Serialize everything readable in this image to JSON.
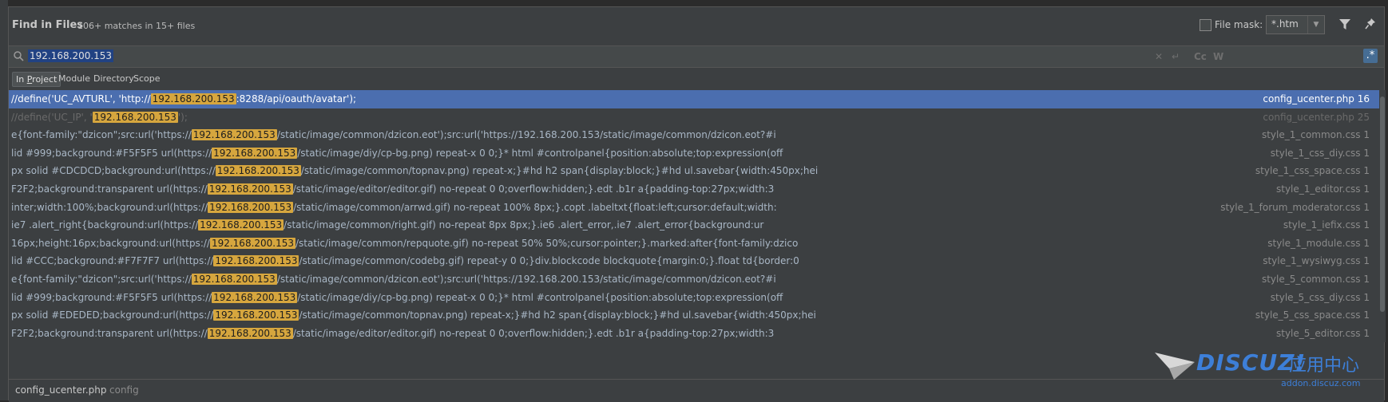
{
  "header": {
    "title": "Find in Files",
    "match_count": "106+ matches in 15+ files",
    "file_mask_label": "File mask:",
    "file_mask_value": "*.htm"
  },
  "search": {
    "query": "192.168.200.153"
  },
  "scopes": [
    "In Project",
    "Module",
    "Directory",
    "Scope"
  ],
  "results": [
    {
      "pre": "//define('UC_AVTURL', 'http://",
      "match": "192.168.200.153",
      "post": ":8288/api/oauth/avatar');",
      "file": "config_ucenter.php 16",
      "selected": true,
      "dim": false
    },
    {
      "pre": "//define('UC_IP', '",
      "match": "192.168.200.153",
      "post": "');",
      "file": "config_ucenter.php 25",
      "selected": false,
      "dim": true
    },
    {
      "pre": "e{font-family:\"dzicon\";src:url('https://",
      "match": "192.168.200.153",
      "post": "/static/image/common/dzicon.eot');src:url('https://192.168.200.153/static/image/common/dzicon.eot?#i",
      "file": "style_1_common.css 1",
      "selected": false,
      "dim": false
    },
    {
      "pre": "lid #999;background:#F5F5F5 url(https://",
      "match": "192.168.200.153",
      "post": "/static/image/diy/cp-bg.png) repeat-x 0 0;}* html #controlpanel{position:absolute;top:expression(off",
      "file": "style_1_css_diy.css 1",
      "selected": false,
      "dim": false
    },
    {
      "pre": "px solid #CDCDCD;background:url(https://",
      "match": "192.168.200.153",
      "post": "/static/image/common/topnav.png) repeat-x;}#hd h2 span{display:block;}#hd ul.savebar{width:450px;hei",
      "file": "style_1_css_space.css 1",
      "selected": false,
      "dim": false
    },
    {
      "pre": "F2F2;background:transparent url(https://",
      "match": "192.168.200.153",
      "post": "/static/image/editor/editor.gif) no-repeat 0 0;overflow:hidden;}.edt .b1r a{padding-top:27px;width:3",
      "file": "style_1_editor.css 1",
      "selected": false,
      "dim": false
    },
    {
      "pre": "inter;width:100%;background:url(https://",
      "match": "192.168.200.153",
      "post": "/static/image/common/arrwd.gif) no-repeat 100% 8px;}.copt .labeltxt{float:left;cursor:default;width:",
      "file": "style_1_forum_moderator.css 1",
      "selected": false,
      "dim": false
    },
    {
      "pre": "ie7 .alert_right{background:url(https://",
      "match": "192.168.200.153",
      "post": "/static/image/common/right.gif) no-repeat 8px 8px;}.ie6 .alert_error,.ie7 .alert_error{background:ur",
      "file": "style_1_iefix.css 1",
      "selected": false,
      "dim": false
    },
    {
      "pre": "16px;height:16px;background:url(https://",
      "match": "192.168.200.153",
      "post": "/static/image/common/repquote.gif) no-repeat 50% 50%;cursor:pointer;}.marked:after{font-family:dzico",
      "file": "style_1_module.css 1",
      "selected": false,
      "dim": false
    },
    {
      "pre": "lid #CCC;background:#F7F7F7 url(https://",
      "match": "192.168.200.153",
      "post": "/static/image/common/codebg.gif) repeat-y 0 0;}div.blockcode blockquote{margin:0;}.float td{border:0",
      "file": "style_1_wysiwyg.css 1",
      "selected": false,
      "dim": false
    },
    {
      "pre": "e{font-family:\"dzicon\";src:url('https://",
      "match": "192.168.200.153",
      "post": "/static/image/common/dzicon.eot');src:url('https://192.168.200.153/static/image/common/dzicon.eot?#i",
      "file": "style_5_common.css 1",
      "selected": false,
      "dim": false
    },
    {
      "pre": "lid #999;background:#F5F5F5 url(https://",
      "match": "192.168.200.153",
      "post": "/static/image/diy/cp-bg.png) repeat-x 0 0;}* html #controlpanel{position:absolute;top:expression(off",
      "file": "style_5_css_diy.css 1",
      "selected": false,
      "dim": false
    },
    {
      "pre": "px solid #EDEDED;background:url(https://",
      "match": "192.168.200.153",
      "post": "/static/image/common/topnav.png) repeat-x;}#hd h2 span{display:block;}#hd ul.savebar{width:450px;hei",
      "file": "style_5_css_space.css 1",
      "selected": false,
      "dim": false
    },
    {
      "pre": "F2F2;background:transparent url(https://",
      "match": "192.168.200.153",
      "post": "/static/image/editor/editor.gif) no-repeat 0 0;overflow:hidden;}.edt .b1r a{padding-top:27px;width:3",
      "file": "style_5_editor.css 1",
      "selected": false,
      "dim": false
    }
  ],
  "footer": {
    "file_name": "config_ucenter.php",
    "file_path": "config"
  },
  "watermark": {
    "brand": "DISCUZ!",
    "cn": "应用中心",
    "sub": "addon.discuz.com"
  },
  "icons": [
    "search-icon",
    "filter-icon",
    "pin-icon",
    "clear-icon",
    "newline-icon",
    "match-case-icon",
    "words-icon",
    "regex-icon",
    "dropdown-arrow-icon"
  ],
  "colors": {
    "selection": "#4b6eaf",
    "match_highlight": "#d6a63e",
    "panel": "#3c3f41",
    "regex_active": "#466d94"
  }
}
